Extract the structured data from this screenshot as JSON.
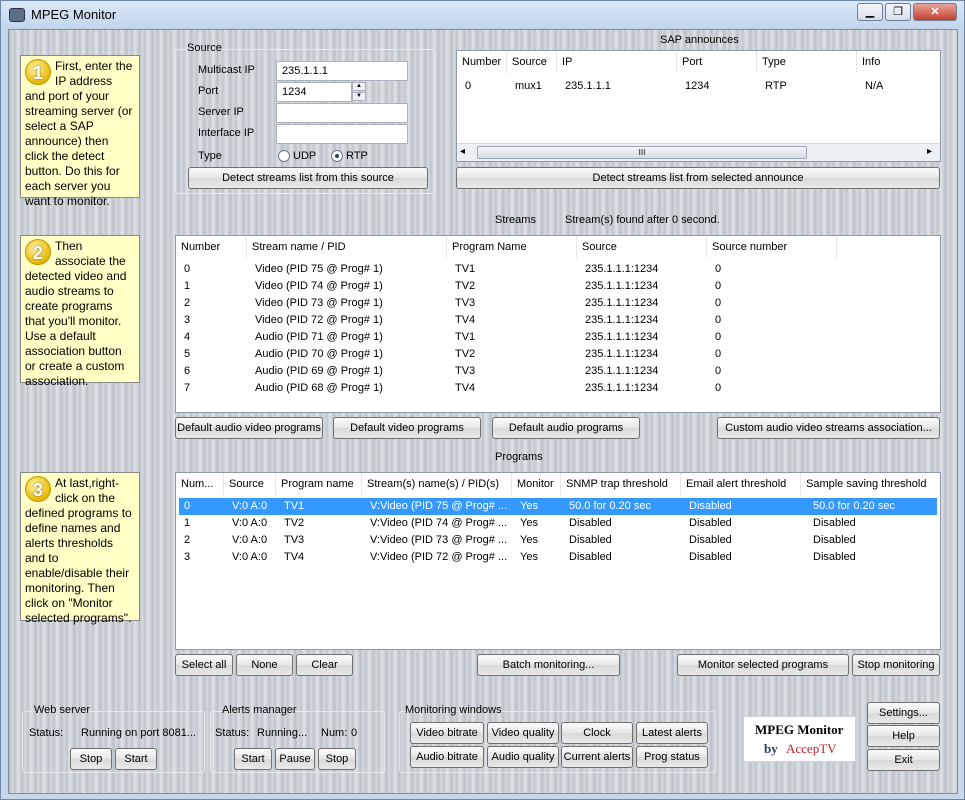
{
  "window": {
    "title": "MPEG Monitor",
    "minimize": "▁",
    "maximize": "❐",
    "close": "✕"
  },
  "notes": {
    "step1": {
      "num": "1",
      "text": "First, enter the IP address and port of your streaming server (or select a SAP announce) then click the detect button. Do this for each server you want to monitor."
    },
    "step2": {
      "num": "2",
      "text": "Then associate the detected video and audio streams to create programs that you'll monitor. Use a default association button or create a custom association."
    },
    "step3": {
      "num": "3",
      "text": "At last,right-click on the defined programs to define names and alerts thresholds and to enable/disable their monitoring. Then click on \"Monitor selected programs\"."
    }
  },
  "source": {
    "title": "Source",
    "multicast_label": "Multicast IP",
    "multicast_value": "235.1.1.1",
    "port_label": "Port",
    "port_value": "1234",
    "server_label": "Server IP",
    "server_value": "",
    "interface_label": "Interface IP",
    "interface_value": "",
    "type_label": "Type",
    "udp_label": "UDP",
    "rtp_label": "RTP",
    "selected_type": "RTP",
    "detect_button": "Detect streams list from this source"
  },
  "sap": {
    "title": "SAP announces",
    "columns": [
      "Number",
      "Source",
      "IP",
      "Port",
      "Type",
      "Info"
    ],
    "rows": [
      [
        "0",
        "mux1",
        "235.1.1.1",
        "1234",
        "RTP",
        "N/A"
      ]
    ],
    "scroll_left": "◂",
    "scroll_right": "▸",
    "scroll_grip": "III",
    "detect_button": "Detect streams list from selected announce"
  },
  "streams": {
    "title": "Streams",
    "status": "Stream(s) found after 0 second.",
    "columns": [
      "Number",
      "Stream name / PID",
      "Program Name",
      "Source",
      "Source number"
    ],
    "rows": [
      [
        "0",
        "Video (PID 75 @ Prog# 1)",
        "TV1",
        "235.1.1.1:1234",
        "0"
      ],
      [
        "1",
        "Video (PID 74 @ Prog# 1)",
        "TV2",
        "235.1.1.1:1234",
        "0"
      ],
      [
        "2",
        "Video (PID 73 @ Prog# 1)",
        "TV3",
        "235.1.1.1:1234",
        "0"
      ],
      [
        "3",
        "Video (PID 72 @ Prog# 1)",
        "TV4",
        "235.1.1.1:1234",
        "0"
      ],
      [
        "4",
        "Audio (PID 71 @ Prog# 1)",
        "TV1",
        "235.1.1.1:1234",
        "0"
      ],
      [
        "5",
        "Audio (PID 70 @ Prog# 1)",
        "TV2",
        "235.1.1.1:1234",
        "0"
      ],
      [
        "6",
        "Audio (PID 69 @ Prog# 1)",
        "TV3",
        "235.1.1.1:1234",
        "0"
      ],
      [
        "7",
        "Audio (PID 68 @ Prog# 1)",
        "TV4",
        "235.1.1.1:1234",
        "0"
      ]
    ],
    "buttons": {
      "default_av": "Default audio video programs",
      "default_video": "Default video programs",
      "default_audio": "Default audio programs",
      "custom": "Custom audio video streams association..."
    }
  },
  "programs": {
    "title": "Programs",
    "columns": [
      "Num...",
      "Source",
      "Program name",
      "Stream(s) name(s) / PID(s)",
      "Monitor",
      "SNMP trap threshold",
      "Email alert threshold",
      "Sample saving threshold"
    ],
    "rows": [
      [
        "0",
        "V:0 A:0",
        "TV1",
        "V:Video (PID 75 @ Prog# ...",
        "Yes",
        "50.0 for 0.20 sec",
        "Disabled",
        "50.0 for 0.20 sec"
      ],
      [
        "1",
        "V:0 A:0",
        "TV2",
        "V:Video (PID 74 @ Prog# ...",
        "Yes",
        "Disabled",
        "Disabled",
        "Disabled"
      ],
      [
        "2",
        "V:0 A:0",
        "TV3",
        "V:Video (PID 73 @ Prog# ...",
        "Yes",
        "Disabled",
        "Disabled",
        "Disabled"
      ],
      [
        "3",
        "V:0 A:0",
        "TV4",
        "V:Video (PID 72 @ Prog# ...",
        "Yes",
        "Disabled",
        "Disabled",
        "Disabled"
      ]
    ],
    "selected_row": 0,
    "buttons": {
      "select_all": "Select all",
      "none": "None",
      "clear": "Clear",
      "batch": "Batch monitoring...",
      "monitor_selected": "Monitor selected programs",
      "stop_monitoring": "Stop monitoring"
    }
  },
  "web_server": {
    "title": "Web server",
    "status_label": "Status:",
    "status_value": "Running on port 8081...",
    "stop": "Stop",
    "start": "Start"
  },
  "alerts_manager": {
    "title": "Alerts manager",
    "status_label": "Status:",
    "status_value": "Running...",
    "num_label": "Num:",
    "num_value": "0",
    "start": "Start",
    "pause": "Pause",
    "stop": "Stop"
  },
  "monitoring_windows": {
    "title": "Monitoring windows",
    "buttons": [
      "Video bitrate",
      "Video quality",
      "Clock",
      "Latest alerts",
      "Audio bitrate",
      "Audio quality",
      "Current alerts",
      "Prog status"
    ]
  },
  "logo": {
    "line1": "MPEG Monitor",
    "by": "by",
    "brand": "AccepTV"
  },
  "side_buttons": {
    "settings": "Settings...",
    "help": "Help",
    "exit": "Exit"
  },
  "colors": {
    "selection": "#3399ff",
    "note_bg": "#ffffc6",
    "brand_red": "#c8202a"
  }
}
